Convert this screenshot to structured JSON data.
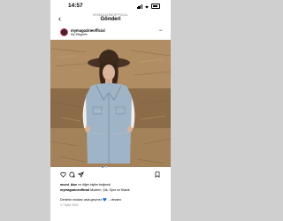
{
  "status_bar": {
    "time": "14:57"
  },
  "nav": {
    "back_icon": "chevron-left-icon",
    "username": "MYMAGAZINEOFFICIAL",
    "title": "Gönderi"
  },
  "post": {
    "username": "mymagazineofficial",
    "location": "My Magazin",
    "likes_user": "mund_blue",
    "likes_suffix": " ve diğer kişiler beğendi",
    "caption_user": "mymagazineofficial",
    "caption_text": " Modern, Şık, Spor ve Klasik",
    "caption_line2": "Denimin modası asla geçmez 💙 ... devamı",
    "comments_time": "17 Eylül 2024"
  },
  "colors": {
    "accent": "#3897f0",
    "text": "#000000",
    "muted": "#8e8e8e"
  },
  "icons": [
    "heart-icon",
    "comment-icon",
    "share-icon",
    "save-icon",
    "more-icon"
  ]
}
